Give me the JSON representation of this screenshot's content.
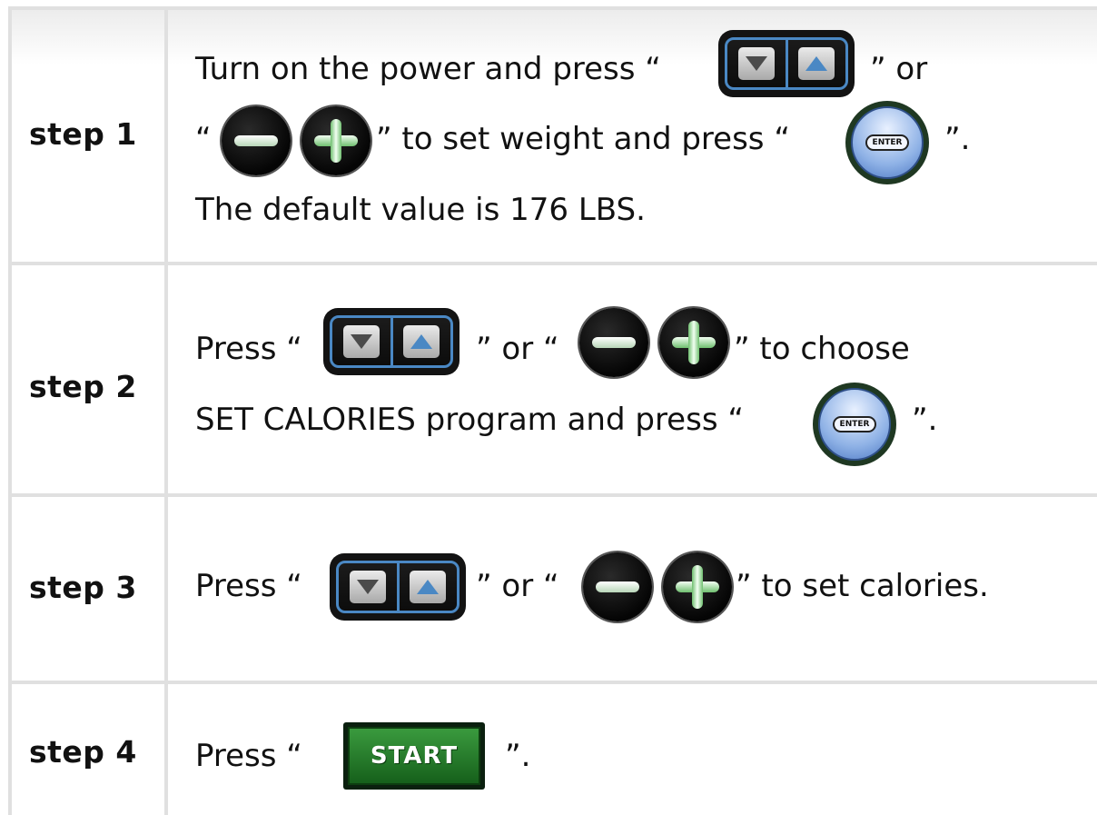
{
  "steps": [
    {
      "label": "step 1",
      "line1_a": "Turn on the power and press “",
      "line1_b": "” or",
      "line2_a": "“",
      "line2_b": "” to set weight and press  “",
      "line2_c": "”.",
      "line3": "The default value is 176 LBS."
    },
    {
      "label": "step 2",
      "line1_a": "Press “",
      "line1_b": "” or “",
      "line1_c": "” to choose",
      "line2_a": "SET CALORIES program and press “",
      "line2_b": "”."
    },
    {
      "label": "step 3",
      "line1_a": "Press “",
      "line1_b": "” or “",
      "line1_c": "” to set calories."
    },
    {
      "label": "step 4",
      "line1_a": "Press  “",
      "line1_b": "”."
    }
  ],
  "buttons": {
    "enter_label": "ENTER",
    "start_label": "START"
  },
  "icons": {
    "arrows": "down-up-arrow-keys-icon",
    "minus": "minus-button-icon",
    "plus": "plus-button-icon",
    "enter": "enter-button-icon",
    "start": "start-button-icon"
  },
  "colors": {
    "arrow_accent": "#4a88c4",
    "plus_minus_glow": "#6fbf6f",
    "enter_blue": "#8fb2e6",
    "start_green": "#2a8a2f"
  }
}
